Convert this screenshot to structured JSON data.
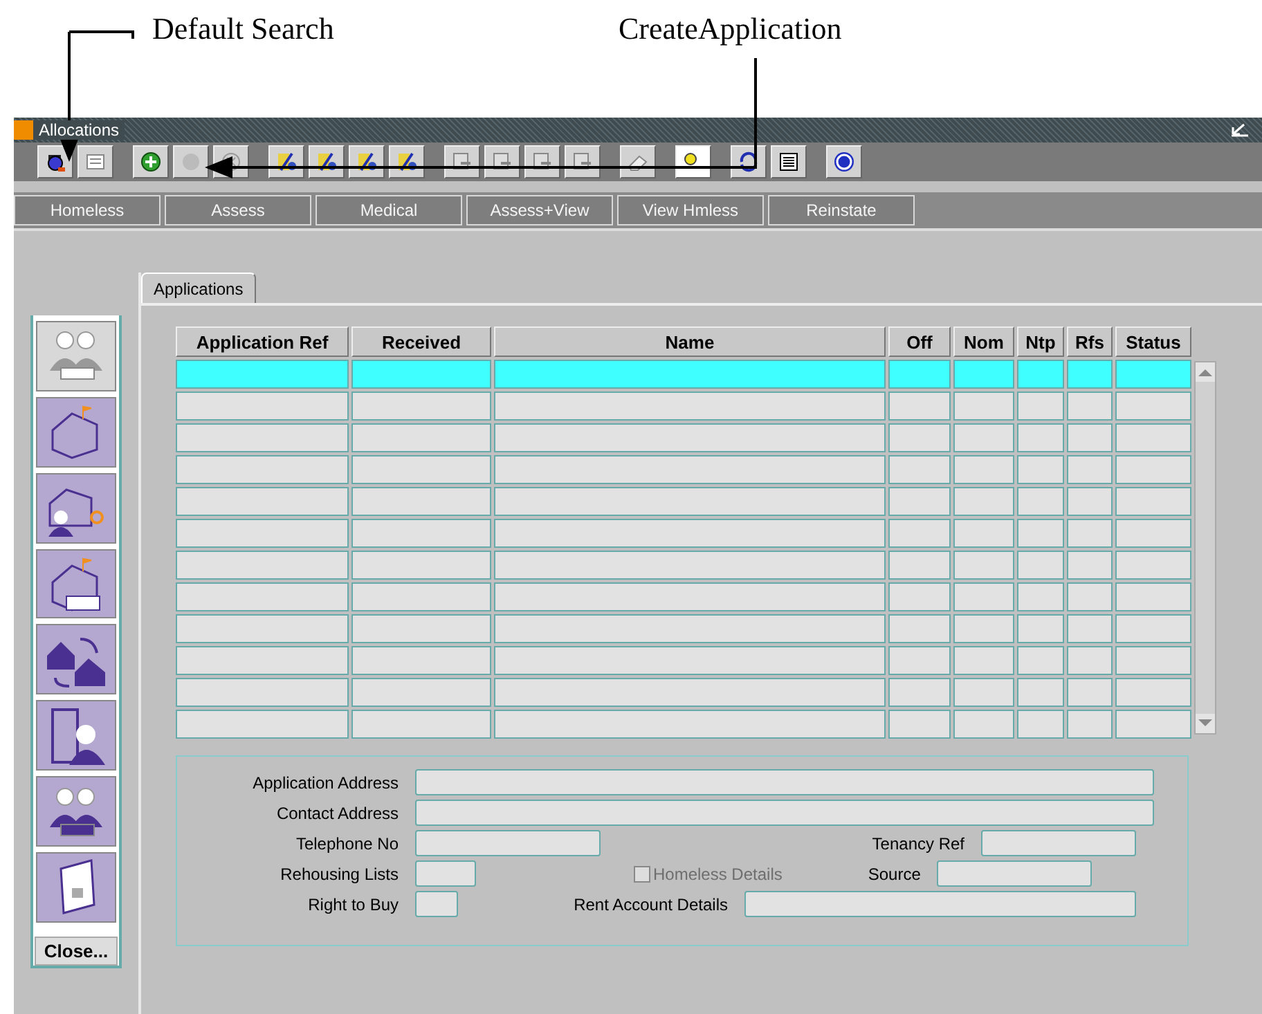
{
  "annotations": [
    {
      "text": "Default Search"
    },
    {
      "text": "CreateApplication"
    }
  ],
  "window": {
    "title": "Allocations"
  },
  "action_buttons": [
    {
      "label": "Homeless",
      "disabled": true
    },
    {
      "label": "Assess",
      "disabled": true
    },
    {
      "label": "Medical",
      "disabled": true
    },
    {
      "label": "Assess+View",
      "disabled": true
    },
    {
      "label": "View Hmless",
      "disabled": true
    },
    {
      "label": "Reinstate",
      "disabled": true
    }
  ],
  "sidebar": {
    "items": [
      {
        "disabled": true
      },
      {
        "disabled": false
      },
      {
        "disabled": false
      },
      {
        "disabled": false
      },
      {
        "disabled": false
      },
      {
        "disabled": false
      },
      {
        "disabled": false
      },
      {
        "disabled": false
      }
    ],
    "close_button": "Close..."
  },
  "tabs": [
    {
      "label": "Applications",
      "selected": true
    }
  ],
  "table": {
    "columns": [
      "Application Ref",
      "Received",
      "Name",
      "Off",
      "Nom",
      "Ntp",
      "Rfs",
      "Status"
    ],
    "rows": [
      {
        "selected": true
      },
      {
        "selected": false
      },
      {
        "selected": false
      },
      {
        "selected": false
      },
      {
        "selected": false
      },
      {
        "selected": false
      },
      {
        "selected": false
      },
      {
        "selected": false
      },
      {
        "selected": false
      },
      {
        "selected": false
      },
      {
        "selected": false
      },
      {
        "selected": false
      }
    ]
  },
  "details": {
    "application_address": "Application Address",
    "contact_address": "Contact Address",
    "telephone_no": "Telephone No",
    "tenancy_ref": "Tenancy Ref",
    "rehousing_lists": "Rehousing Lists",
    "homeless_details": {
      "label": "Homeless Details",
      "checked": false,
      "disabled": true
    },
    "source": "Source",
    "right_to_buy": "Right to Buy",
    "rent_account_details": "Rent Account Details"
  }
}
